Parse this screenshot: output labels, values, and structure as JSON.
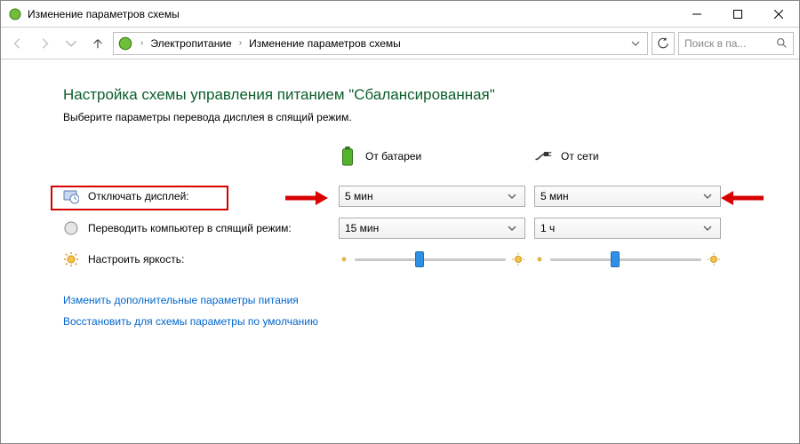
{
  "window": {
    "title": "Изменение параметров схемы"
  },
  "breadcrumb": {
    "item1": "Электропитание",
    "item2": "Изменение параметров схемы"
  },
  "search": {
    "placeholder": "Поиск в па..."
  },
  "page": {
    "heading": "Настройка схемы управления питанием \"Сбалансированная\"",
    "subtext": "Выберите параметры перевода дисплея в спящий режим."
  },
  "columns": {
    "battery": "От батареи",
    "pluggedin": "От сети"
  },
  "rows": {
    "display_off": "Отключать дисплей:",
    "sleep": "Переводить компьютер в спящий режим:",
    "brightness": "Настроить яркость:"
  },
  "values": {
    "display_off_battery": "5 мин",
    "display_off_plugged": "5 мин",
    "sleep_battery": "15 мин",
    "sleep_plugged": "1 ч",
    "brightness_battery_pct": 40,
    "brightness_plugged_pct": 40
  },
  "links": {
    "advanced": "Изменить дополнительные параметры питания",
    "restore": "Восстановить для схемы параметры по умолчанию"
  }
}
